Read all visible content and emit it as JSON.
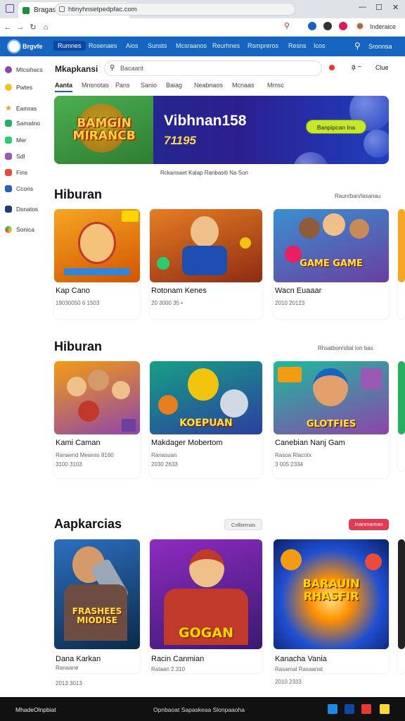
{
  "browser": {
    "tab_title": "Bragasmon",
    "url": "htinyhnsetpedpfac.com",
    "profile_label": "Inderaice"
  },
  "appnav": {
    "brand": "Brgvfe",
    "tabs": [
      "Rumnes",
      "Rosenaes",
      "Aios",
      "Sunsts",
      "Mcsraanos",
      "Reurhnes",
      "Rsmpreros",
      "Resns",
      "Icos"
    ],
    "right_label": "Sronnsa"
  },
  "sidebar": {
    "items": [
      {
        "label": "Mtcsihacs",
        "icon": "purple-circle-icon",
        "color": "#8e44ad"
      },
      {
        "label": "Pwtes",
        "icon": "yellow-badge-icon",
        "color": "#f1c40f"
      },
      {
        "label": "Eamras",
        "icon": "star-icon",
        "color": "#f39c12"
      },
      {
        "label": "Samatno",
        "icon": "green-square-icon",
        "color": "#27ae60"
      },
      {
        "label": "Mer",
        "icon": "green-square-icon",
        "color": "#2ecc71"
      },
      {
        "label": "Sdl",
        "icon": "purple-square-icon",
        "color": "#9b59b6"
      },
      {
        "label": "Fins",
        "icon": "red-square-icon",
        "color": "#e74c3c"
      },
      {
        "label": "Ccons",
        "icon": "blue-square-icon",
        "color": "#2e5fbf"
      },
      {
        "label": "Dsnatos",
        "icon": "navy-square-icon",
        "color": "#1f3a7a"
      },
      {
        "label": "Sonica",
        "icon": "multi-color-icon",
        "color": "#2ecc71"
      }
    ]
  },
  "header": {
    "title": "Mkapkansi",
    "search_value": "Bacaant",
    "subtabs": [
      "Aanta",
      "Mnsnotas",
      "Pans",
      "Sanio",
      "Baiag",
      "Neabnaos",
      "Mcnaas",
      "Mmsc"
    ],
    "icon_right_1": "a̧ ~",
    "icon_right_2": "Clue"
  },
  "banner": {
    "logo_text_1": "BAMGIN",
    "logo_text_2": "MIRANCB",
    "title": "Vibhnan158",
    "subtitle": "71195",
    "button_label": "Banpipcan Ina",
    "caption": "Rckansaet Kalap Ranbasiti Na Son"
  },
  "sections": [
    {
      "title": "Hiburan",
      "link": "Raunrban/lasanau",
      "cards": [
        {
          "title": "Kap Cano",
          "meta": "19030050 6 1503",
          "meta2": "",
          "thumb_text": "",
          "bg": [
            "#f5a623",
            "#d35400"
          ]
        },
        {
          "title": "Rotonam Kenes",
          "meta": "20 3000 35 •",
          "meta2": "",
          "thumb_text": "",
          "bg": [
            "#e67e22",
            "#8e2b14"
          ]
        },
        {
          "title": "Wacn Euaaar",
          "meta": "2010 20123",
          "meta2": "",
          "thumb_text": "GAME GAME",
          "bg": [
            "#3a8fd1",
            "#6a3fa0"
          ]
        }
      ]
    },
    {
      "title": "Hiburan",
      "link": "Rhsatbon/sltal lon bas",
      "cards": [
        {
          "title": "Kami Caman",
          "meta": "Ranaend Meanss 8160",
          "meta2": "3100 3103",
          "thumb_text": "",
          "bg": [
            "#f39c12",
            "#8e44ad"
          ]
        },
        {
          "title": "Makdager Mobertom",
          "meta": "Ranasuan",
          "meta2": "2030 2633",
          "thumb_text": "KOEPUAN",
          "bg": [
            "#16a085",
            "#2c3e9f"
          ]
        },
        {
          "title": "Canebian Nanj Gam",
          "meta": "Rasoa Rlacotx",
          "meta2": "3 005 2334",
          "thumb_text": "GLOTFIES",
          "bg": [
            "#1abc9c",
            "#8e44ad"
          ]
        }
      ]
    },
    {
      "title": "Aapkarcias",
      "link_left": "Colbernas",
      "link_right": "Inanmarean",
      "cards": [
        {
          "title": "Dana Karkan",
          "meta": "Ranaane",
          "meta2": "2013 3013",
          "thumb_text": "FRASHEES MIODISE",
          "bg": [
            "#2c6fbf",
            "#0b2a4a"
          ]
        },
        {
          "title": "Racin Canmian",
          "meta": "Rataan 2.310",
          "meta2": "",
          "thumb_text": "GOGAN",
          "bg": [
            "#8e2bbf",
            "#3a1a70"
          ]
        },
        {
          "title": "Kanacha Vania",
          "meta": "Rasamal Rasaanat",
          "meta2": "2010 2333",
          "thumb_text": "BARAUIN RHASFIR",
          "bg": [
            "#1f4fd1",
            "#0d1f6a"
          ]
        }
      ]
    }
  ],
  "taskbar": {
    "left_label": "MhadeOlnpbiat",
    "mid_label": "Opnbaoat Sapaskeaa Slonpaaoha"
  }
}
